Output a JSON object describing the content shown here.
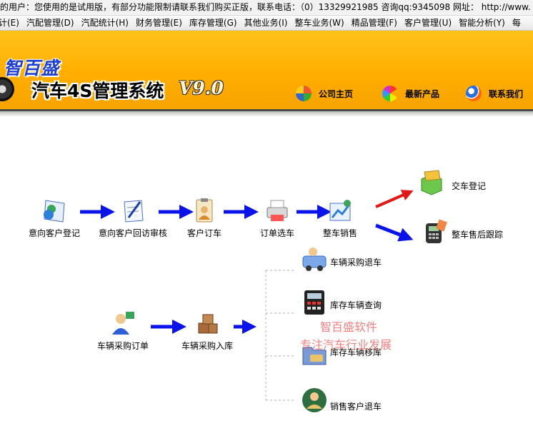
{
  "notice": "的用户：您使用的是试用版，有部分功能限制请联系我们购买正版，联系电话：（0）13329921985  咨询qq:9345098   网址： http://www.",
  "menu": [
    "计(E)",
    "汽配管理(D)",
    "汽配统计(H)",
    "财务管理(E)",
    "库存管理(G)",
    "其他业务(I)",
    "整车业务(W)",
    "精品管理(F)",
    "客户管理(U)",
    "智能分析(Y)",
    "每"
  ],
  "banner": {
    "brand": "智百盛",
    "title": "汽车4S管理系统",
    "version": "V9.0",
    "nav": [
      "公司主页",
      "最新产品",
      "联系我们"
    ]
  },
  "flow": {
    "row1": [
      "意向客户登记",
      "意向客户回访审核",
      "客户订车",
      "订单选车",
      "整车销售"
    ],
    "outcomes": [
      "交车登记",
      "整车售后跟踪"
    ],
    "row2": [
      "车辆采购订单",
      "车辆采购入库"
    ],
    "branches": [
      "车辆采购退车",
      "库存车辆查询",
      "库存车辆移库",
      "销售客户退车"
    ]
  },
  "watermark": [
    "智百盛软件",
    "专注汽车行业发展"
  ],
  "colors": {
    "banner": "#ffae00",
    "arrow": "#0a14e8",
    "red_arrow": "#e01818",
    "watermark": "#ef6a6a"
  }
}
